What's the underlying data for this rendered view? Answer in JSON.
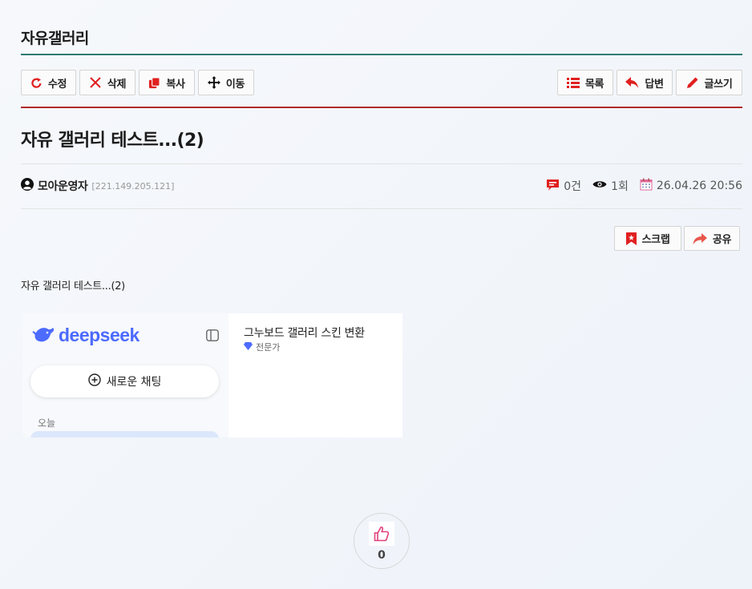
{
  "board": {
    "title": "자유갤러리"
  },
  "toolbar": {
    "edit_label": "수정",
    "delete_label": "삭제",
    "copy_label": "복사",
    "move_label": "이동",
    "list_label": "목록",
    "reply_label": "답변",
    "write_label": "글쓰기"
  },
  "post": {
    "title": "자유 갤러리 테스트...(2)",
    "author": "모아운영자",
    "ip": "[221.149.205.121]",
    "comments": "0건",
    "views": "1회",
    "date": "26.04.26 20:56",
    "body": "자유 갤러리 테스트...(2)"
  },
  "share": {
    "scrap_label": "스크랩",
    "share_label": "공유"
  },
  "embedded": {
    "logo_text": "deepseek",
    "new_chat_label": "새로운 채팅",
    "today_label": "오늘",
    "card_title": "그누보드 갤러리 스킨 변환",
    "card_badge": "전문가"
  },
  "like": {
    "count": "0"
  },
  "colors": {
    "teal_rule": "#2f7b74",
    "red_rule": "#b02a2a",
    "icon_red": "#e02020",
    "deepseek_blue": "#4d6bfe"
  }
}
